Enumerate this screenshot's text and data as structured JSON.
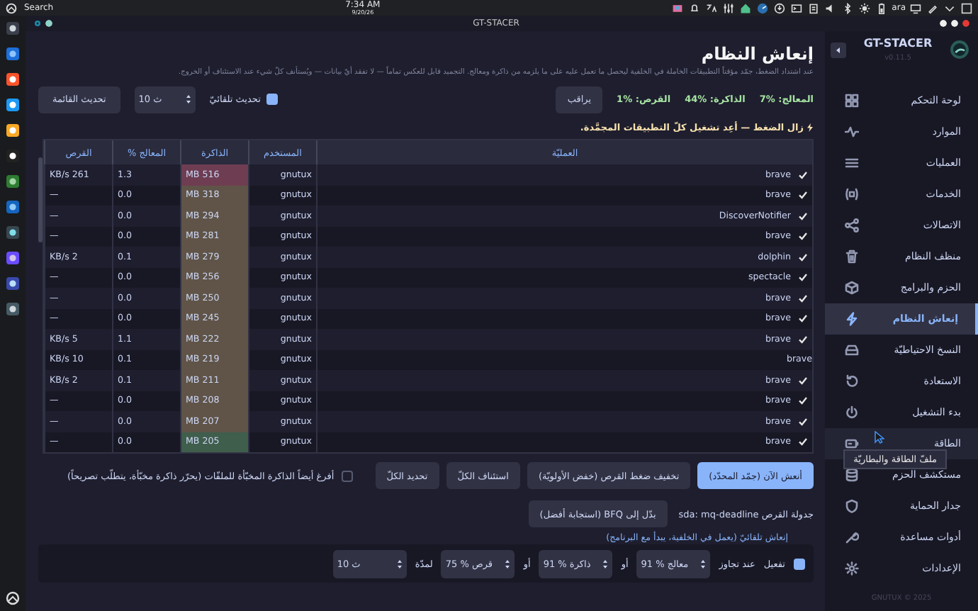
{
  "top_panel": {
    "search_label": "Search",
    "time": "7:34 AM",
    "date": "9/20/26",
    "keyboard_layout": "ara"
  },
  "window": {
    "title": "GT-STACER"
  },
  "sidebar": {
    "brand": "GT-STACER",
    "version": "v0.11.5",
    "footer": "GNUTUX © 2025",
    "items": [
      {
        "label": "لوحة التحكم",
        "selected": false
      },
      {
        "label": "الموارد",
        "selected": false
      },
      {
        "label": "العمليات",
        "selected": false
      },
      {
        "label": "الخدمات",
        "selected": false
      },
      {
        "label": "الاتصالات",
        "selected": false
      },
      {
        "label": "منظف النظام",
        "selected": false
      },
      {
        "label": "الحزم والبرامج",
        "selected": false
      },
      {
        "label": "إنعاش النظام",
        "selected": true
      },
      {
        "label": "النسخ الاحتياطيّة",
        "selected": false
      },
      {
        "label": "الاستعادة",
        "selected": false
      },
      {
        "label": "بدء التشغيل",
        "selected": false
      },
      {
        "label": "الطاقة",
        "selected": false
      },
      {
        "label": "مستكشف الحزم",
        "selected": false
      },
      {
        "label": "جدار الحماية",
        "selected": false
      },
      {
        "label": "أدوات مساعدة",
        "selected": false
      },
      {
        "label": "الإعدادات",
        "selected": false
      }
    ],
    "tooltip": "ملفّ الطاقة والبطاريّة"
  },
  "page": {
    "title": "إنعاش النظام",
    "description": "عند اشتداد الضغط، جمّد مؤقتاً التطبيقات الخاملة في الخلفية ليحصل ما تعمل عليه على ما يلزمه من ذاكرة ومعالج. التجميد قابل للعكس تماماً — لا تفقد أيّ بيانات — ويُستأنف كلّ شيء عند الاستئناف أو الخروج.",
    "stats": [
      "المعالج: %7",
      "الذاكرة: %44",
      "القرص: %1"
    ],
    "monitor_button": "يراقب",
    "auto_refresh": {
      "label": "تحديث تلقائيّ",
      "checked": true,
      "interval": "10 ث"
    },
    "refresh_button": "تحديث القائمة",
    "notice": "زال الضغط — أعِد تشغيل كلّ التطبيقات المجمَّدة."
  },
  "table": {
    "columns": [
      "العمليّة",
      "المستخدم",
      "الذاكرة",
      "المعالج %",
      "القرص"
    ],
    "rows": [
      {
        "checked": true,
        "process": "brave",
        "user": "gnutux",
        "memory": "MB 516",
        "cpu": "1.3",
        "disk": "KB/s 261",
        "color": "#6e3d52"
      },
      {
        "checked": true,
        "process": "brave",
        "user": "gnutux",
        "memory": "MB 318",
        "cpu": "0.0",
        "disk": "—",
        "color": "#5f5447"
      },
      {
        "checked": true,
        "process": "DiscoverNotifier",
        "user": "gnutux",
        "memory": "MB 294",
        "cpu": "0.0",
        "disk": "—",
        "color": "#5f5447"
      },
      {
        "checked": true,
        "process": "brave",
        "user": "gnutux",
        "memory": "MB 281",
        "cpu": "0.0",
        "disk": "—",
        "color": "#5f5447"
      },
      {
        "checked": true,
        "process": "dolphin",
        "user": "gnutux",
        "memory": "MB 279",
        "cpu": "0.1",
        "disk": "KB/s 2",
        "color": "#5f5447"
      },
      {
        "checked": true,
        "process": "spectacle",
        "user": "gnutux",
        "memory": "MB 256",
        "cpu": "0.0",
        "disk": "—",
        "color": "#5f5447"
      },
      {
        "checked": true,
        "process": "brave",
        "user": "gnutux",
        "memory": "MB 250",
        "cpu": "0.0",
        "disk": "—",
        "color": "#5f5447"
      },
      {
        "checked": true,
        "process": "brave",
        "user": "gnutux",
        "memory": "MB 245",
        "cpu": "0.0",
        "disk": "—",
        "color": "#5f5447"
      },
      {
        "checked": true,
        "process": "brave",
        "user": "gnutux",
        "memory": "MB 222",
        "cpu": "1.1",
        "disk": "KB/s 5",
        "color": "#5f5447"
      },
      {
        "checked": false,
        "process": "brave",
        "user": "gnutux",
        "memory": "MB 219",
        "cpu": "0.1",
        "disk": "KB/s 10",
        "color": "#5f5447"
      },
      {
        "checked": true,
        "process": "brave",
        "user": "gnutux",
        "memory": "MB 211",
        "cpu": "0.1",
        "disk": "KB/s 2",
        "color": "#5f5447"
      },
      {
        "checked": true,
        "process": "brave",
        "user": "gnutux",
        "memory": "MB 208",
        "cpu": "0.0",
        "disk": "—",
        "color": "#5f5447"
      },
      {
        "checked": true,
        "process": "brave",
        "user": "gnutux",
        "memory": "MB 207",
        "cpu": "0.0",
        "disk": "—",
        "color": "#5f5447"
      },
      {
        "checked": true,
        "process": "brave",
        "user": "gnutux",
        "memory": "MB 205",
        "cpu": "0.0",
        "disk": "—",
        "color": "#3f5e4c"
      }
    ]
  },
  "actions": {
    "buttons": [
      {
        "label": "أنعش الآن (جمّد المحدّد)",
        "kind": "primary"
      },
      {
        "label": "تخفيف ضغط القرص (خفض الأولويّة)",
        "kind": "normal"
      },
      {
        "label": "استئناف الكلّ",
        "kind": "normal"
      },
      {
        "label": "تحديد الكلّ",
        "kind": "normal"
      }
    ],
    "drop_caches": {
      "label": "أفرغ أيضاً الذاكرة المخبّأة للملفّات (يحرّر ذاكرة مخبّأة، يتطلّب تصريحاً)",
      "checked": false
    },
    "scheduler_label": "جدولة القرص sda: mq-deadline",
    "scheduler_button": "بدّل إلى BFQ (استجابة أفضل)"
  },
  "auto_freeze": {
    "title": "إنعاش تلقائيّ (يعمل في الخلفية، يبدأ مع البرنامج)",
    "enable": {
      "label": "تفعيل",
      "checked": true
    },
    "parts": [
      {
        "kind": "text",
        "text": "عند تجاوز"
      },
      {
        "kind": "field",
        "value": "91 % معالج"
      },
      {
        "kind": "text",
        "text": "أو"
      },
      {
        "kind": "field",
        "value": "91 % ذاكرة"
      },
      {
        "kind": "text",
        "text": "أو"
      },
      {
        "kind": "field",
        "value": "75 % قرص"
      },
      {
        "kind": "text",
        "text": "لمدّة"
      },
      {
        "kind": "field",
        "value": "10 ث"
      }
    ]
  }
}
